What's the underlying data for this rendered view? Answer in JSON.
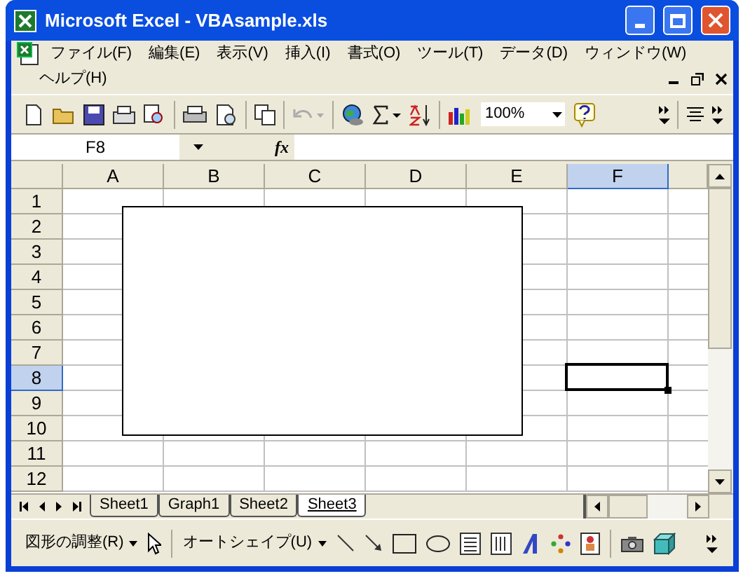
{
  "window": {
    "title": "Microsoft Excel - VBAsample.xls"
  },
  "menu": [
    {
      "label": "ファイル(F)"
    },
    {
      "label": "編集(E)"
    },
    {
      "label": "表示(V)"
    },
    {
      "label": "挿入(I)"
    },
    {
      "label": "書式(O)"
    },
    {
      "label": "ツール(T)"
    },
    {
      "label": "データ(D)"
    },
    {
      "label": "ウィンドウ(W)"
    },
    {
      "label": "ヘルプ(H)"
    }
  ],
  "toolbar": {
    "zoom": "100%"
  },
  "formula_bar": {
    "name_box": "F8",
    "fx": "fx"
  },
  "columns": [
    {
      "label": "A",
      "selected": false
    },
    {
      "label": "B",
      "selected": false
    },
    {
      "label": "C",
      "selected": false
    },
    {
      "label": "D",
      "selected": false
    },
    {
      "label": "E",
      "selected": false
    },
    {
      "label": "F",
      "selected": true
    },
    {
      "selected": false
    }
  ],
  "rows": [
    {
      "label": "1",
      "selected": false
    },
    {
      "label": "2",
      "selected": false
    },
    {
      "label": "3",
      "selected": false
    },
    {
      "label": "4",
      "selected": false
    },
    {
      "label": "5",
      "selected": false
    },
    {
      "label": "6",
      "selected": false
    },
    {
      "label": "7",
      "selected": false
    },
    {
      "label": "8",
      "selected": true
    },
    {
      "label": "9",
      "selected": false
    },
    {
      "label": "10",
      "selected": false
    },
    {
      "label": "11",
      "selected": false
    },
    {
      "label": "12",
      "selected": false
    }
  ],
  "sheet_tabs": [
    {
      "label": "Sheet1",
      "selected": false
    },
    {
      "label": "Graph1",
      "selected": false
    },
    {
      "label": "Sheet2",
      "selected": false
    },
    {
      "label": "Sheet3",
      "selected": true
    }
  ],
  "drawing_toolbar": [
    {
      "label": "図形の調整(R)"
    },
    {
      "label": "オートシェイプ(U)"
    }
  ]
}
